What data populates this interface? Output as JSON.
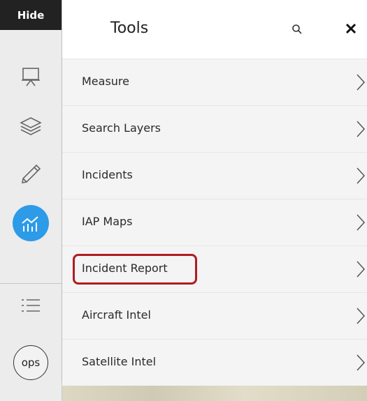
{
  "toolbar": {
    "hide_label": "Hide",
    "buttons": [
      {
        "icon": "presentation-board-icon"
      },
      {
        "icon": "layers-icon"
      },
      {
        "icon": "pencil-icon"
      },
      {
        "icon": "chart-trend-icon",
        "active": true
      },
      {
        "icon": "list-icon"
      },
      {
        "label": "ops"
      }
    ],
    "active_color": "#2d9be8"
  },
  "panel": {
    "title": "Tools",
    "search_icon": "search-icon",
    "close_label": "✕"
  },
  "tools": [
    {
      "label": "Measure"
    },
    {
      "label": "Search Layers"
    },
    {
      "label": "Incidents"
    },
    {
      "label": "IAP Maps"
    },
    {
      "label": "Incident Report",
      "highlighted": true
    },
    {
      "label": "Aircraft Intel"
    },
    {
      "label": "Satellite Intel"
    }
  ],
  "highlight_color": "#b01c20"
}
